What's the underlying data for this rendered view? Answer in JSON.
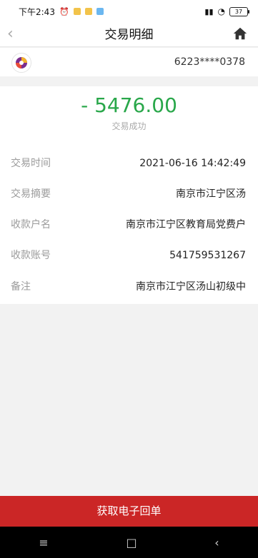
{
  "status_bar": {
    "time": "下午2:43",
    "battery": "37"
  },
  "header": {
    "title": "交易明细"
  },
  "account": {
    "number": "6223****0378"
  },
  "transaction": {
    "amount": "- 5476.00",
    "status": "交易成功",
    "rows": [
      {
        "label": "交易时间",
        "value": "2021-06-16 14:42:49"
      },
      {
        "label": "交易摘要",
        "value": "南京市江宁区汤"
      },
      {
        "label": "收款户名",
        "value": "南京市江宁区教育局党费户"
      },
      {
        "label": "收款账号",
        "value": "541759531267"
      },
      {
        "label": "备注",
        "value": "南京市江宁区汤山初级中"
      }
    ]
  },
  "actions": {
    "receipt_button": "获取电子回单"
  },
  "system_nav": {
    "menu": "≡",
    "home": "□",
    "back": "‹"
  }
}
